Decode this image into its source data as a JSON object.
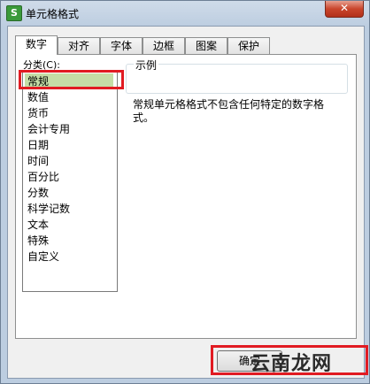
{
  "window": {
    "icon_glyph": "S",
    "title": "单元格格式",
    "close_glyph": "✕"
  },
  "tabs": [
    {
      "label": "数字",
      "active": true
    },
    {
      "label": "对齐"
    },
    {
      "label": "字体"
    },
    {
      "label": "边框"
    },
    {
      "label": "图案"
    },
    {
      "label": "保护"
    }
  ],
  "category": {
    "label": "分类(C):",
    "items": [
      "常规",
      "数值",
      "货币",
      "会计专用",
      "日期",
      "时间",
      "百分比",
      "分数",
      "科学记数",
      "文本",
      "特殊",
      "自定义"
    ],
    "selected": "常规"
  },
  "sample": {
    "legend": "示例"
  },
  "description": "常规单元格格式不包含任何特定的数字格式。",
  "buttons": {
    "ok": "确定"
  },
  "watermark": "云南龙网",
  "colors": {
    "highlight": "#e11b22",
    "selected_item": "#c5dda6"
  }
}
